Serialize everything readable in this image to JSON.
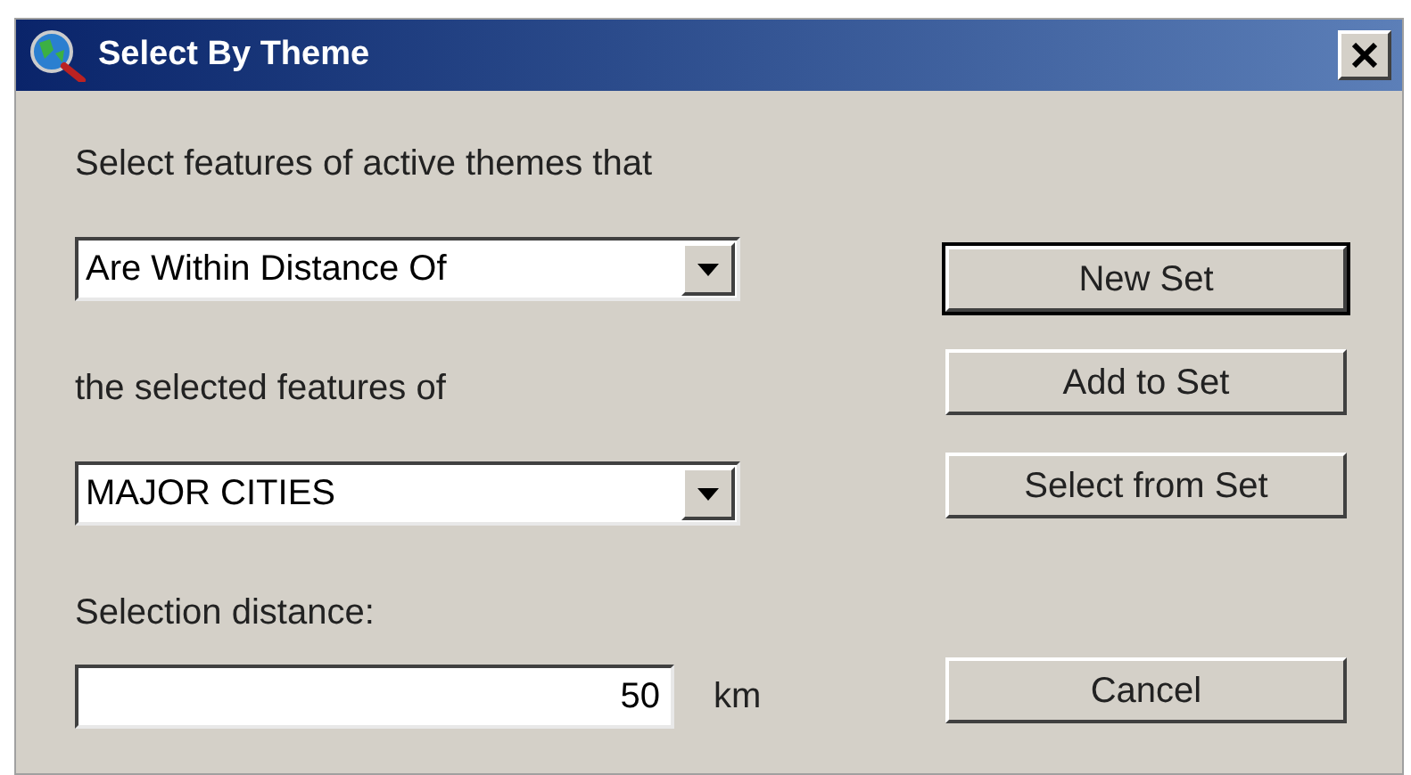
{
  "window": {
    "title": "Select By Theme"
  },
  "prompt": "Select features of active themes that",
  "relation": {
    "value": "Are Within Distance Of"
  },
  "source_label": "the selected features of",
  "theme": {
    "value": "MAJOR CITIES"
  },
  "distance": {
    "label": "Selection distance:",
    "value": "50",
    "unit": "km"
  },
  "buttons": [
    {
      "label": "New Set",
      "default": true
    },
    {
      "label": "Add to Set",
      "default": false
    },
    {
      "label": "Select from Set",
      "default": false
    },
    {
      "label": "Cancel",
      "default": false
    }
  ]
}
